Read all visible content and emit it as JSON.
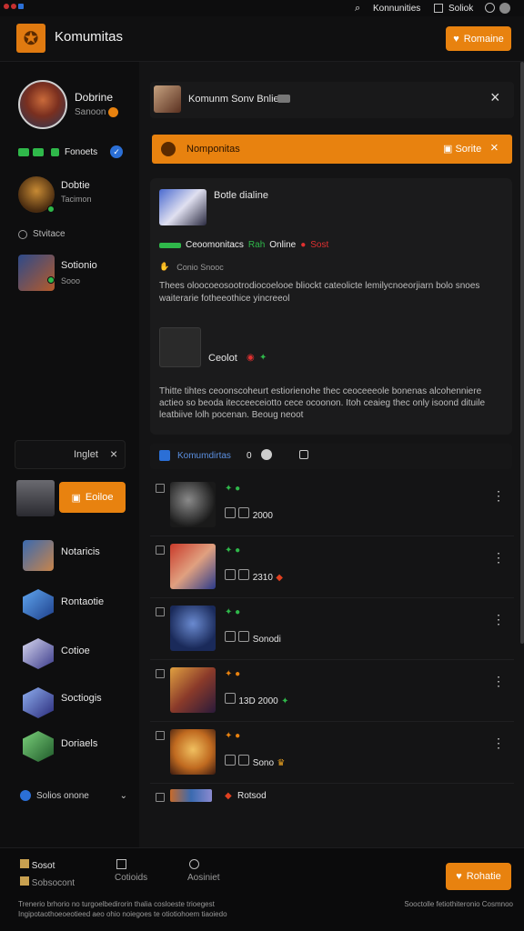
{
  "topbar": {
    "nav_label": "Konnunities",
    "search_label": "Soliok"
  },
  "header": {
    "app_title": "Komumitas",
    "action_label": "Romaine"
  },
  "sidebar": {
    "profile": {
      "name": "Dobrine",
      "sub": "Sanoon"
    },
    "friends_label": "Fonoets",
    "friends": [
      {
        "name": "Dobtie",
        "sub": "Tacimon"
      },
      {
        "name": "Sotionio",
        "sub": "Sooo"
      }
    ],
    "section_label": "Stvitace",
    "search": {
      "value": "Inglet",
      "close": "×"
    },
    "cta_label": "Eoiloe",
    "channels": [
      {
        "name": "Notaricis"
      },
      {
        "name": "Rontaotie"
      },
      {
        "name": "Cotioe"
      },
      {
        "name": "Soctiogis"
      },
      {
        "name": "Doriaels"
      }
    ],
    "footer_select": "Solios onone"
  },
  "panel": {
    "title": "Komunm Sonv Bnlie",
    "close": "×",
    "banner_title": "Nomponitas",
    "banner_action": "Sorite",
    "post1": {
      "title": "Botle dialine",
      "meta_a": "Ceoomonitacs",
      "meta_b": "Rah",
      "meta_c": "Online",
      "meta_d": "Sost",
      "sub": "Conio Snooc",
      "body": "Thees oloocoeosootrodiocoelooe bliockt cateolicte lemilycnoeorjiarn bolo snoes waiterarie fotheeothice yincreeol"
    },
    "post2": {
      "title": "Ceolot",
      "body": "Thitte tihtes ceoonscoheurt estiorienohe thec ceoceeeole bonenas alcohenniere actieo so beoda itecceeceiotto cece ocoonon. Itoh ceaieg thec only isoond dituile leatbiive lolh pocenan. Beoug neoot"
    },
    "list_header": {
      "label": "Komumdirtas",
      "count": "0"
    },
    "items": [
      {
        "meta": "2000"
      },
      {
        "meta": "2310"
      },
      {
        "meta": "Sonodi"
      },
      {
        "meta": "13D 2000"
      },
      {
        "meta": "Sono"
      },
      {
        "meta": "Rotsod"
      }
    ]
  },
  "footer": {
    "col1_a": "Sosot",
    "col1_b": "Sobsocont",
    "col2": "Cotioids",
    "col3": "Aosiniet",
    "action_label": "Rohatie",
    "legal_left": "Trenerio brhorio no turgoelbedirorin thalia cosloeste trioegest Ingipotaothoeoeotieed aeo ohio noiegoes te otiotiohoem tiaoiedo",
    "legal_right": "Sooctolle fetiothiteronio Cosmnoo"
  },
  "colors": {
    "accent": "#e8820f",
    "bg": "#0d0d0e",
    "panel": "#141415",
    "card": "#1b1b1c",
    "online": "#2fb84a",
    "link": "#5b8fe0"
  }
}
